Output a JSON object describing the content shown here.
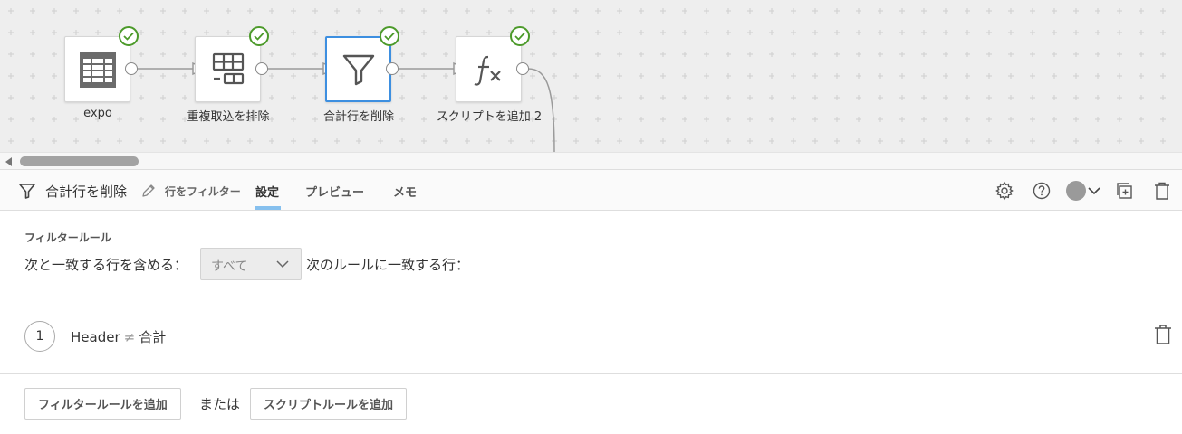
{
  "flow": {
    "nodes": [
      {
        "label": "expo",
        "icon": "table-icon",
        "status": "complete"
      },
      {
        "label": "重複取込を排除",
        "icon": "dedupe-icon",
        "status": "complete"
      },
      {
        "label": "合計行を削除",
        "icon": "filter-icon",
        "status": "complete",
        "selected": true
      },
      {
        "label": "スクリプトを追加 2",
        "icon": "formula-icon",
        "status": "complete"
      }
    ]
  },
  "toolbar": {
    "title": "合計行を削除",
    "subtitle": "行をフィルター",
    "tabs": [
      {
        "label": "設定",
        "active": true
      },
      {
        "label": "プレビュー",
        "active": false
      },
      {
        "label": "メモ",
        "active": false
      }
    ],
    "icons": [
      "settings-icon",
      "help-icon",
      "color-picker",
      "duplicate-icon",
      "trash-icon"
    ]
  },
  "filter": {
    "section_title": "フィルタールール",
    "include_label": "次と一致する行を含める：",
    "match_select": "すべて",
    "rule_suffix": "次のルールに一致する行：",
    "rules": [
      {
        "number": "1",
        "field": "Header",
        "operator": "≠",
        "value": "合計"
      }
    ],
    "add_filter_rule": "フィルタールールを追加",
    "or_text": "または",
    "add_script_rule": "スクリプトルールを追加"
  },
  "colors": {
    "accent": "#3d8fe0",
    "success": "#4c9a2a",
    "canvas_bg": "#eeeeee",
    "tab_underline": "#86c0ee"
  }
}
